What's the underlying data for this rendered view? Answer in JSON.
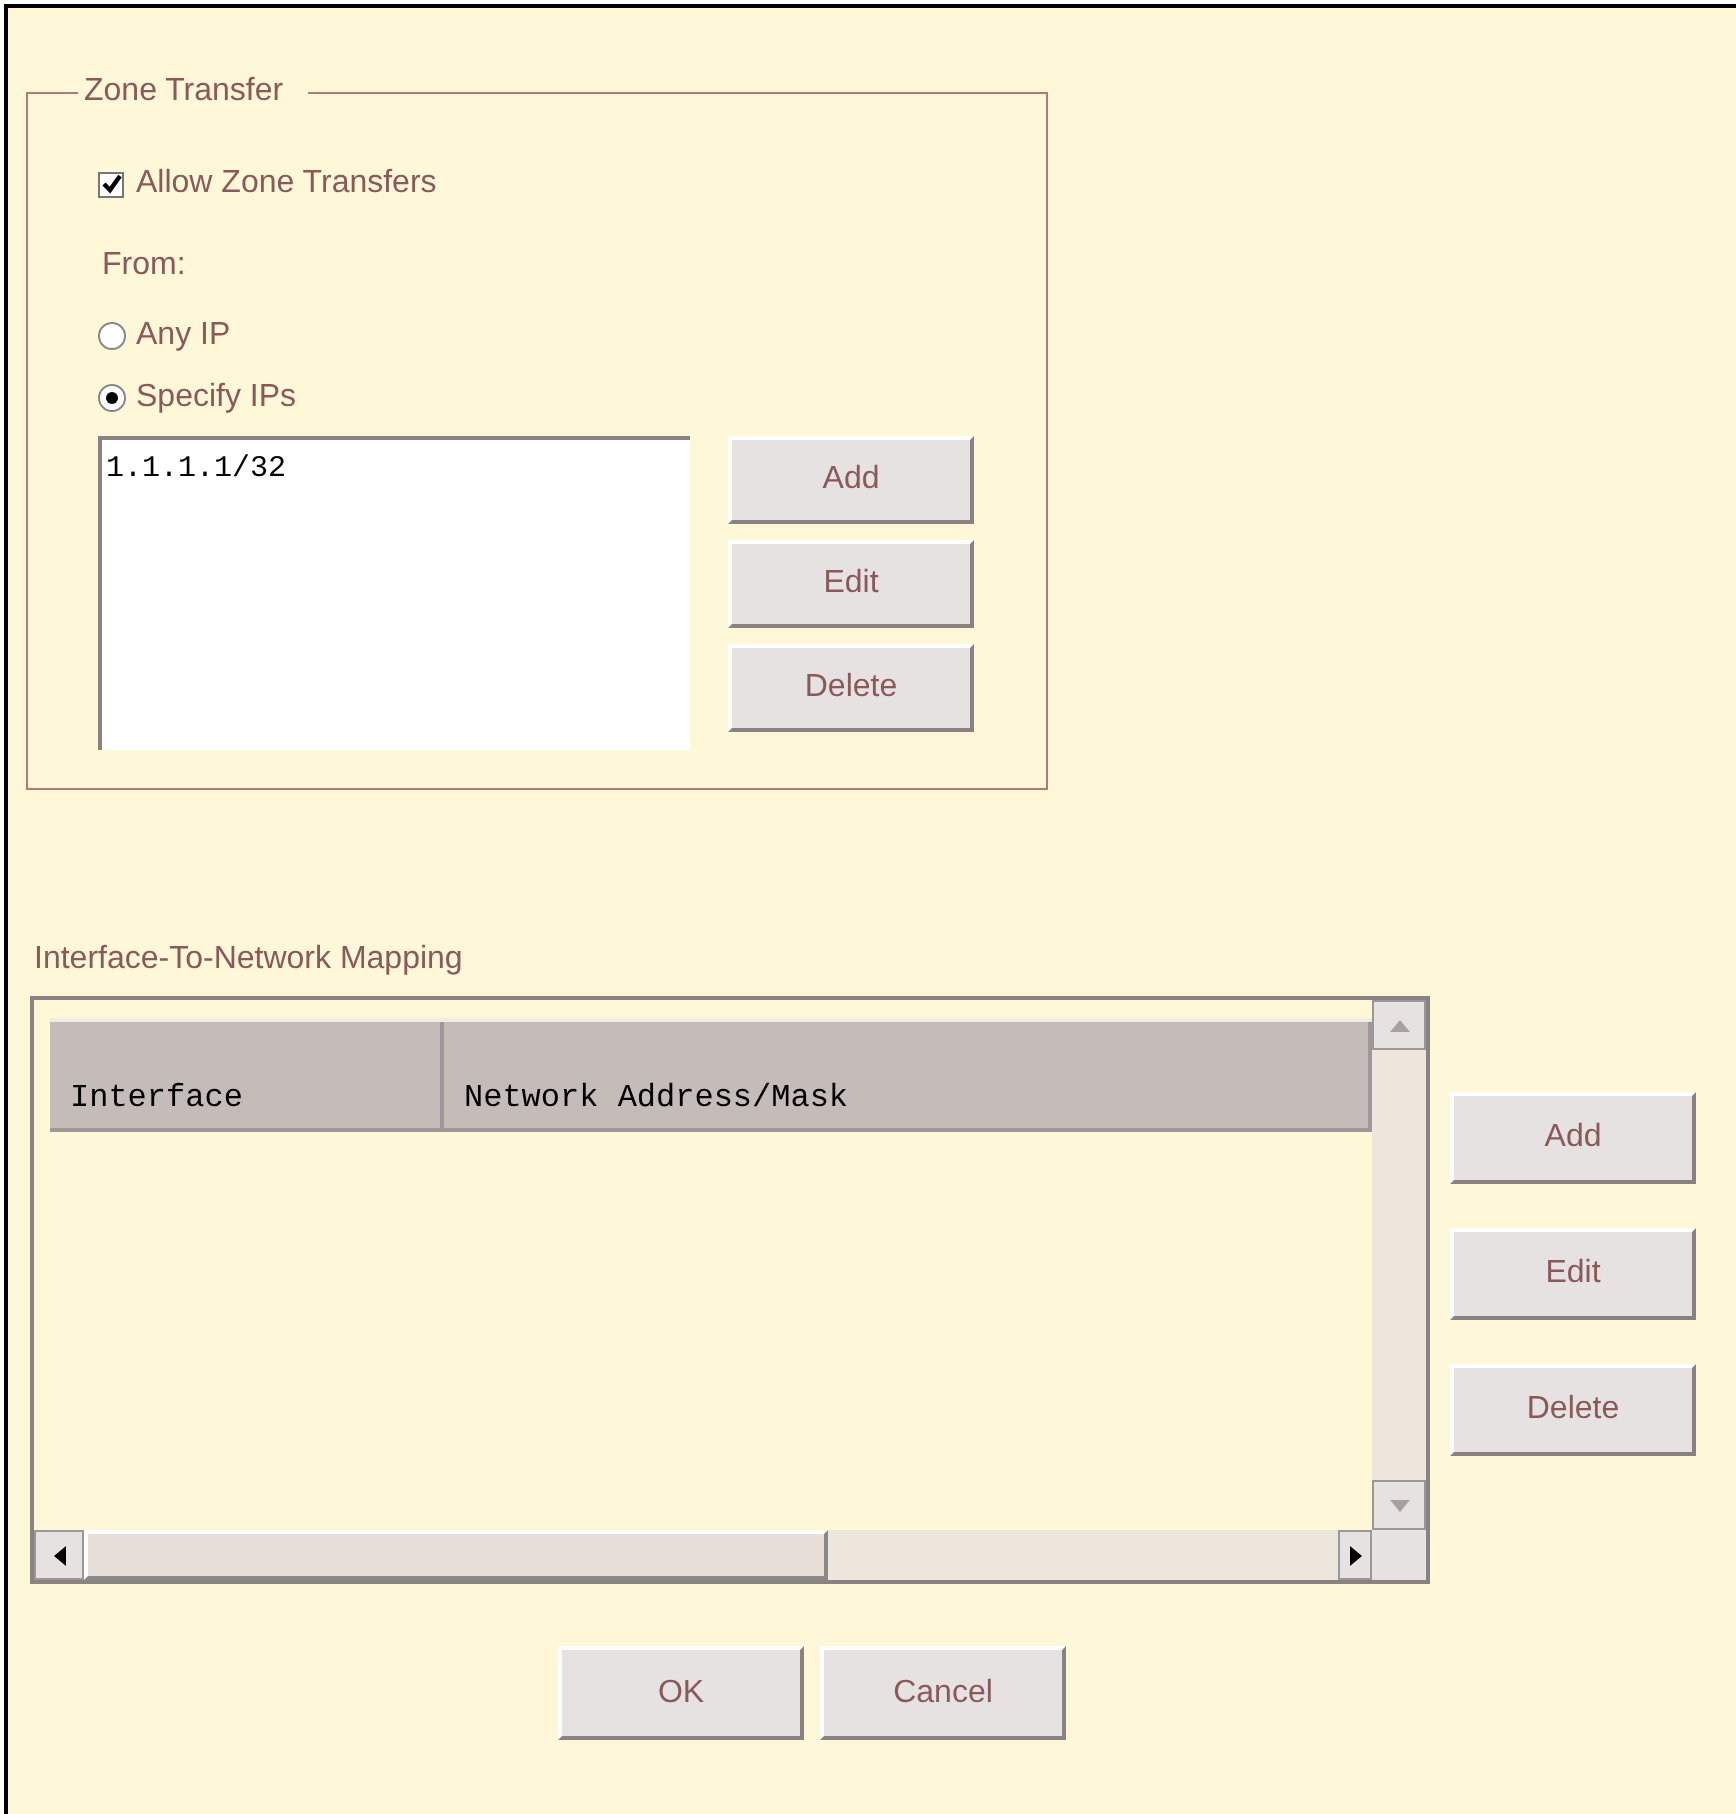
{
  "zone_transfer": {
    "title": "Zone Transfer",
    "allow_checkbox": {
      "label": "Allow Zone Transfers",
      "checked": true
    },
    "from_label": "From:",
    "radios": [
      {
        "label": "Any IP",
        "selected": false
      },
      {
        "label": "Specify IPs",
        "selected": true
      }
    ],
    "ip_list": [
      "1.1.1.1/32"
    ],
    "buttons": [
      "Add",
      "Edit",
      "Delete"
    ]
  },
  "mapping": {
    "title": "Interface-To-Network Mapping",
    "columns": [
      "Interface",
      "Network Address/Mask"
    ],
    "buttons": [
      "Add",
      "Edit",
      "Delete"
    ]
  },
  "dialog_buttons": [
    "OK",
    "Cancel"
  ]
}
